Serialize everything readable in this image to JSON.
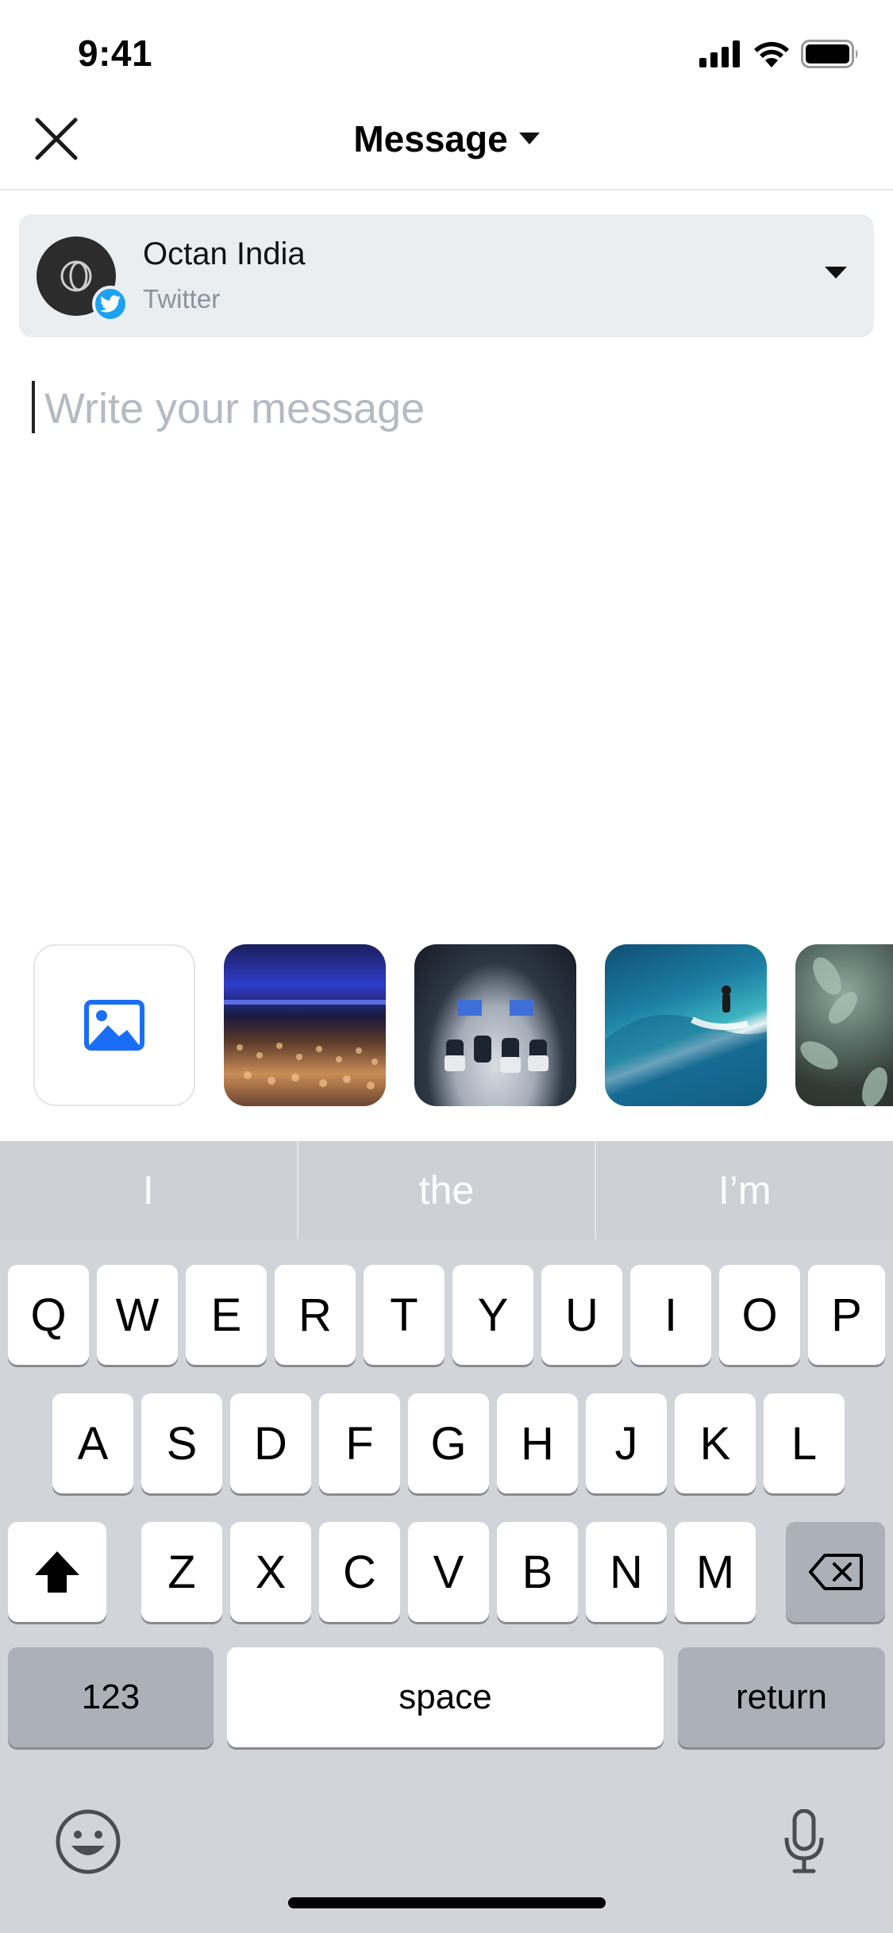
{
  "status_bar": {
    "time": "9:41"
  },
  "nav": {
    "title": "Message"
  },
  "account": {
    "name": "Octan India",
    "network": "Twitter"
  },
  "composer": {
    "placeholder": "Write your message",
    "value": ""
  },
  "media": {
    "add_icon": "image-icon",
    "thumbnails": [
      "concert-crowd",
      "panel-discussion",
      "surfer-wave",
      "succulent-plants"
    ]
  },
  "keyboard": {
    "suggestions": [
      "I",
      "the",
      "I’m"
    ],
    "row1": [
      "Q",
      "W",
      "E",
      "R",
      "T",
      "Y",
      "U",
      "I",
      "O",
      "P"
    ],
    "row2": [
      "A",
      "S",
      "D",
      "F",
      "G",
      "H",
      "J",
      "K",
      "L"
    ],
    "row3": [
      "Z",
      "X",
      "C",
      "V",
      "B",
      "N",
      "M"
    ],
    "numbers_label": "123",
    "space_label": "space",
    "return_label": "return"
  },
  "colors": {
    "twitter": "#1da1f2",
    "accent": "#1a6ef5",
    "keyboard_bg": "#d1d4d9"
  }
}
